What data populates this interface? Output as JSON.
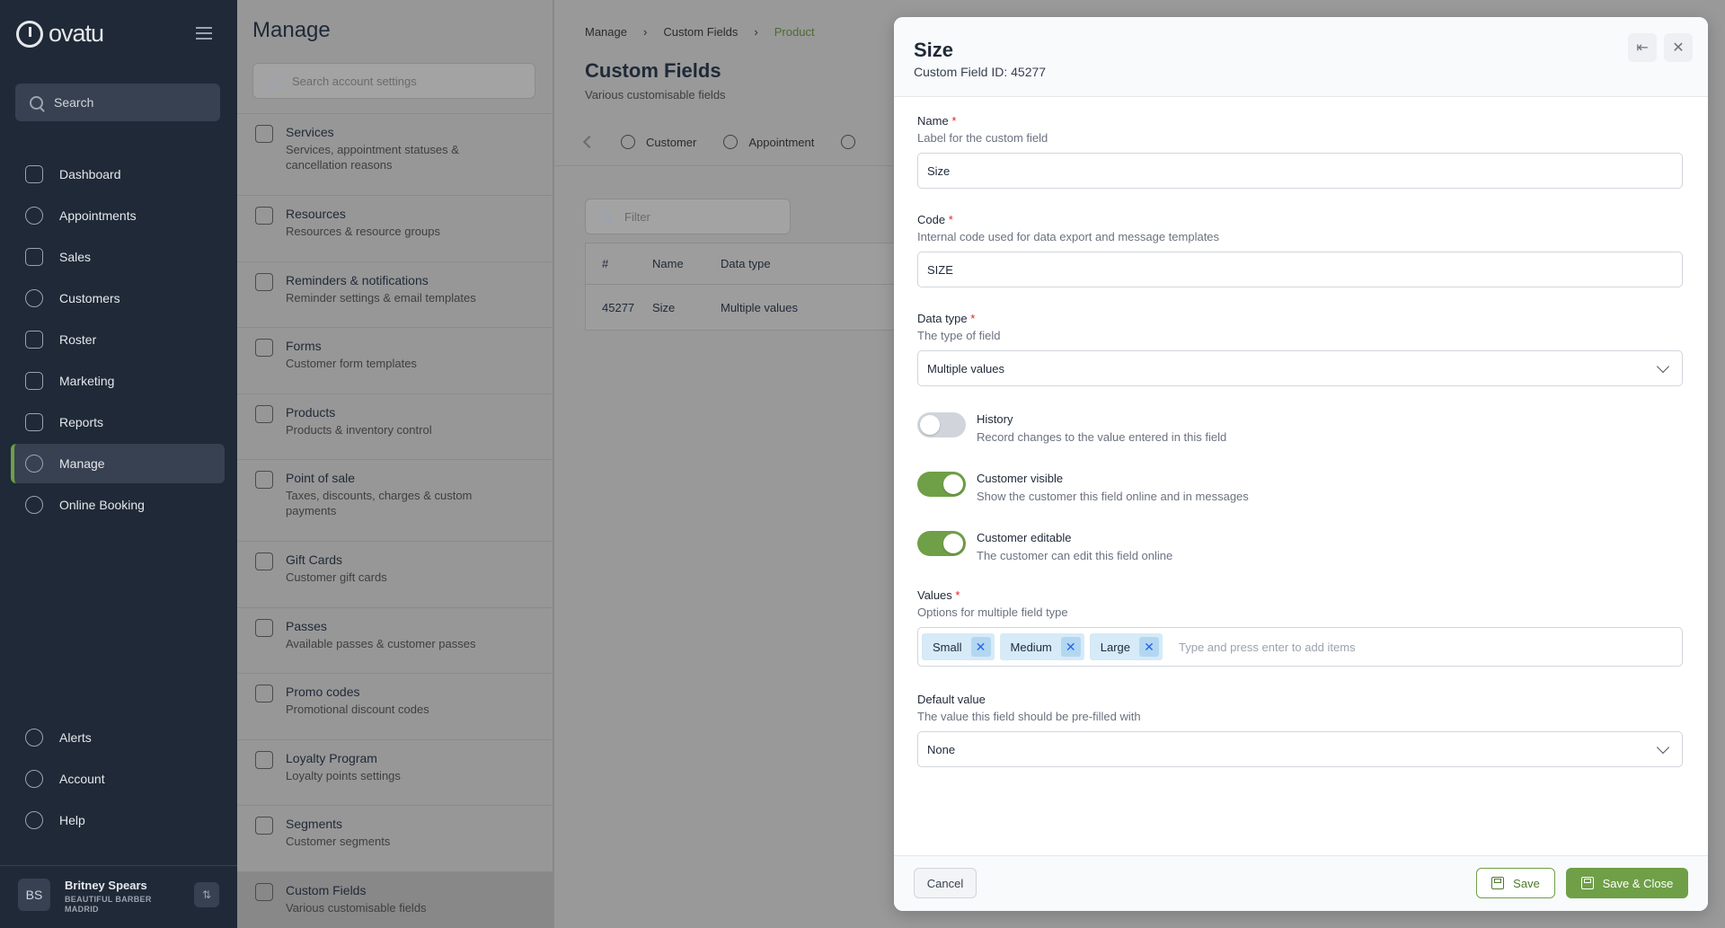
{
  "nav": {
    "brand": "ovatu",
    "search_label": "Search",
    "items": [
      {
        "label": "Dashboard",
        "icon": "home-icon"
      },
      {
        "label": "Appointments",
        "icon": "clock-icon"
      },
      {
        "label": "Sales",
        "icon": "tag-icon"
      },
      {
        "label": "Customers",
        "icon": "users-icon"
      },
      {
        "label": "Roster",
        "icon": "calendar-icon"
      },
      {
        "label": "Marketing",
        "icon": "megaphone-icon"
      },
      {
        "label": "Reports",
        "icon": "bar-chart-icon"
      },
      {
        "label": "Manage",
        "icon": "gears-icon"
      },
      {
        "label": "Online Booking",
        "icon": "globe-icon"
      }
    ],
    "bottom": [
      {
        "label": "Alerts",
        "icon": "bell-icon"
      },
      {
        "label": "Account",
        "icon": "account-icon"
      },
      {
        "label": "Help",
        "icon": "help-icon"
      }
    ],
    "user": {
      "initials": "BS",
      "name": "Britney Spears",
      "business": "BEAUTIFUL BARBER MADRID"
    }
  },
  "manage": {
    "title": "Manage",
    "search_placeholder": "Search account settings",
    "items": [
      {
        "title": "Services",
        "sub": "Services, appointment statuses & cancellation reasons"
      },
      {
        "title": "Resources",
        "sub": "Resources & resource groups"
      },
      {
        "title": "Reminders & notifications",
        "sub": "Reminder settings & email templates"
      },
      {
        "title": "Forms",
        "sub": "Customer form templates"
      },
      {
        "title": "Products",
        "sub": "Products & inventory control"
      },
      {
        "title": "Point of sale",
        "sub": "Taxes, discounts, charges & custom payments"
      },
      {
        "title": "Gift Cards",
        "sub": "Customer gift cards"
      },
      {
        "title": "Passes",
        "sub": "Available passes & customer passes"
      },
      {
        "title": "Promo codes",
        "sub": "Promotional discount codes"
      },
      {
        "title": "Loyalty Program",
        "sub": "Loyalty points settings"
      },
      {
        "title": "Segments",
        "sub": "Customer segments"
      },
      {
        "title": "Custom Fields",
        "sub": "Various customisable fields"
      }
    ]
  },
  "main": {
    "breadcrumbs": [
      "Manage",
      "Custom Fields",
      "Product"
    ],
    "title": "Custom Fields",
    "subtitle": "Various customisable fields",
    "tabs": [
      "Customer",
      "Appointment"
    ],
    "filter_placeholder": "Filter",
    "table": {
      "headers": [
        "#",
        "Name",
        "Data type"
      ],
      "rows": [
        [
          "45277",
          "Size",
          "Multiple values"
        ]
      ]
    }
  },
  "modal": {
    "title": "Size",
    "subtitle": "Custom Field ID: 45277",
    "name": {
      "label": "Name",
      "hint": "Label for the custom field",
      "value": "Size"
    },
    "code": {
      "label": "Code",
      "hint": "Internal code used for data export and message templates",
      "value": "SIZE"
    },
    "data_type": {
      "label": "Data type",
      "hint": "The type of field",
      "value": "Multiple values"
    },
    "history": {
      "label": "History",
      "hint": "Record changes to the value entered in this field",
      "on": false
    },
    "customer_visible": {
      "label": "Customer visible",
      "hint": "Show the customer this field online and in messages",
      "on": true
    },
    "customer_editable": {
      "label": "Customer editable",
      "hint": "The customer can edit this field online",
      "on": true
    },
    "values": {
      "label": "Values",
      "hint": "Options for multiple field type",
      "tags": [
        "Small",
        "Medium",
        "Large"
      ],
      "placeholder": "Type and press enter to add items"
    },
    "default_value": {
      "label": "Default value",
      "hint": "The value this field should be pre-filled with",
      "value": "None"
    },
    "required_mark": "*",
    "buttons": {
      "cancel": "Cancel",
      "save": "Save",
      "save_close": "Save & Close"
    }
  },
  "colors": {
    "accent": "#6f9f47",
    "nav_bg": "#1f2937",
    "tag_bg": "#d6eaf8",
    "required": "#dc2626"
  }
}
